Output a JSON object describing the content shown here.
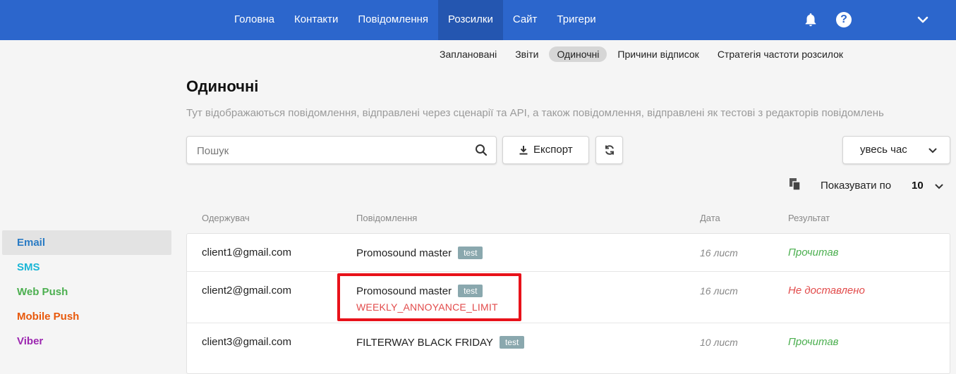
{
  "topnav": [
    "Головна",
    "Контакти",
    "Повідомлення",
    "Розсилки",
    "Сайт",
    "Тригери"
  ],
  "topnav_active": 3,
  "icons": {
    "bell": "bell-icon",
    "help": "help-icon",
    "help_glyph": "?",
    "account": "chevron-down-icon"
  },
  "subnav": [
    "Заплановані",
    "Звіти",
    "Одиночні",
    "Причини відписок",
    "Стратегія частоти розсилок"
  ],
  "subnav_active": 2,
  "sidebar": [
    {
      "label": "Email",
      "color": "#2a7bc4"
    },
    {
      "label": "SMS",
      "color": "#1ab6d6"
    },
    {
      "label": "Web Push",
      "color": "#4caf50"
    },
    {
      "label": "Mobile Push",
      "color": "#e8590c"
    },
    {
      "label": "Viber",
      "color": "#9c27b0"
    }
  ],
  "page": {
    "title": "Одиночні",
    "description": "Тут відображаються повідомлення, відправлені через сценарії та API, а також повідомлення, відправлені як тестові з редакторів повідомлень"
  },
  "toolbar": {
    "search_placeholder": "Пошук",
    "export_label": "Експорт",
    "period_label": "увесь час"
  },
  "perpage": {
    "label": "Показувати по",
    "value": "10"
  },
  "table": {
    "headers": [
      "Одержувач",
      "Повідомлення",
      "Дата",
      "Результат"
    ],
    "rows": [
      {
        "recipient": "client1@gmail.com",
        "message": "Promosound master",
        "tag": "test",
        "error": "",
        "date": "16 лист",
        "result": "Прочитав",
        "result_color": "#4caf50"
      },
      {
        "recipient": "client2@gmail.com",
        "message": "Promosound master",
        "tag": "test",
        "error": "WEEKLY_ANNOYANCE_LIMIT",
        "date": "16 лист",
        "result": "Не доставлено",
        "result_color": "#e24b4b"
      },
      {
        "recipient": "client3@gmail.com",
        "message": "FILTERWAY BLACK FRIDAY",
        "tag": "test",
        "error": "",
        "date": "10 лист",
        "result": "Прочитав",
        "result_color": "#4caf50"
      }
    ]
  }
}
